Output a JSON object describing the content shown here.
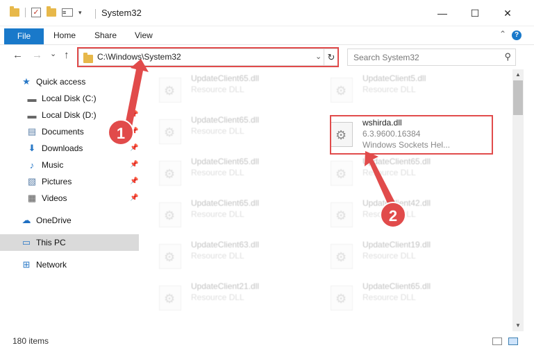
{
  "window": {
    "title": "System32",
    "minimize": "—",
    "maximize": "☐",
    "close": "✕"
  },
  "ribbon": {
    "file": "File",
    "home": "Home",
    "share": "Share",
    "view": "View",
    "help": "?",
    "collapse": "⌃"
  },
  "nav": {
    "back": "←",
    "forward": "→",
    "recent": "⌄",
    "up": "↑"
  },
  "address": {
    "path": "C:\\Windows\\System32",
    "dropdown": "⌄",
    "refresh": "↻"
  },
  "search": {
    "placeholder": "Search System32",
    "icon": "⚲"
  },
  "sidebar": {
    "items": [
      {
        "label": "Quick access",
        "icon": "★"
      },
      {
        "label": "Local Disk (C:)",
        "icon": "▬"
      },
      {
        "label": "Local Disk (D:)",
        "icon": "▬"
      },
      {
        "label": "Documents",
        "icon": "▤"
      },
      {
        "label": "Downloads",
        "icon": "⬇"
      },
      {
        "label": "Music",
        "icon": "♪"
      },
      {
        "label": "Pictures",
        "icon": "▧"
      },
      {
        "label": "Videos",
        "icon": "▦"
      },
      {
        "label": "OneDrive",
        "icon": "☁"
      },
      {
        "label": "This PC",
        "icon": "▭"
      },
      {
        "label": "Network",
        "icon": "⊞"
      }
    ],
    "pin": "📌"
  },
  "files": {
    "left": [
      {
        "name": "UpdateClient65.dll",
        "desc": "Resource DLL"
      },
      {
        "name": "UpdateClient65.dll",
        "desc": "Resource DLL"
      },
      {
        "name": "UpdateClient65.dll",
        "desc": "Resource DLL"
      },
      {
        "name": "UpdateClient65.dll",
        "desc": "Resource DLL"
      },
      {
        "name": "UpdateClient63.dll",
        "desc": "Resource DLL"
      },
      {
        "name": "UpdateClient21.dll",
        "desc": "Resource DLL"
      }
    ],
    "right": [
      {
        "name": "UpdateClient5.dll",
        "desc": "Resource DLL"
      },
      {
        "name": "UpdateClient65.dll",
        "desc": "Resource DLL"
      },
      {
        "name": "UpdateClient42.dll",
        "desc": "Resource DLL"
      },
      {
        "name": "UpdateClient19.dll",
        "desc": "Resource DLL"
      },
      {
        "name": "UpdateClient65.dll",
        "desc": "Resource DLL"
      }
    ],
    "highlight": {
      "name": "wshirda.dll",
      "version": "6.3.9600.16384",
      "desc": "Windows Sockets Hel..."
    }
  },
  "status": {
    "count": "180 items"
  },
  "markers": {
    "one": "1",
    "two": "2"
  },
  "colors": {
    "accent": "#1979ca",
    "annotation": "#e14b4b"
  }
}
